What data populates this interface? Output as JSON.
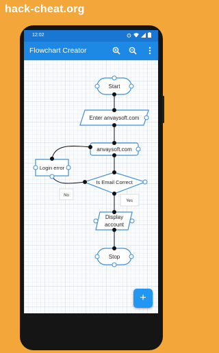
{
  "banner": {
    "text": "hack-cheat.org"
  },
  "status_bar": {
    "time": "12:02"
  },
  "app_bar": {
    "title": "Flowchart Creator"
  },
  "flowchart": {
    "nodes": {
      "start": "Start",
      "input": "Enter anvaysoft.com",
      "process": "anvaysoft.com",
      "error": "Login error",
      "decision": "Is Email Correct",
      "no_label": "No",
      "yes_label": "Yes",
      "display_line1": "Display",
      "display_line2": "account",
      "stop": "Stop"
    }
  },
  "fab": {
    "label": "+"
  },
  "colors": {
    "banner_bg": "#f3a63a",
    "statusbar": "#1976d2",
    "appbar": "#1e88e5",
    "node_border": "#3d8fd8",
    "fab": "#2196f3"
  },
  "icons": [
    "zoom-in-icon",
    "zoom-out-icon",
    "more-vert-icon",
    "add-icon"
  ]
}
